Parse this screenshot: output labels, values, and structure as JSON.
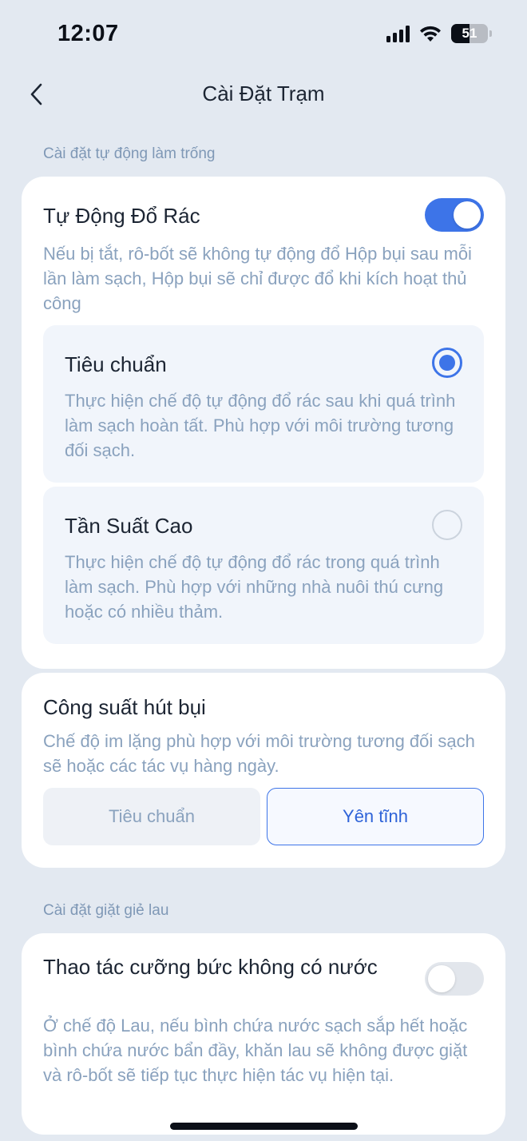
{
  "status_bar": {
    "time": "12:07",
    "battery_level": "51"
  },
  "nav": {
    "title": "Cài Đặt Trạm"
  },
  "sections": {
    "auto_empty_header": "Cài đặt tự động làm trống",
    "mop_wash_header": "Cài đặt giặt giẻ lau"
  },
  "auto_empty": {
    "title": "Tự Động Đổ Rác",
    "enabled": true,
    "description": "Nếu bị tắt, rô-bốt sẽ không tự động đổ Hộp bụi sau mỗi lần làm sạch, Hộp bụi sẽ chỉ được đổ khi kích hoạt thủ công",
    "options": [
      {
        "title": "Tiêu chuẩn",
        "description": "Thực hiện chế độ tự động đổ rác sau khi quá trình làm sạch hoàn tất. Phù hợp với môi trường tương đối sạch.",
        "selected": true
      },
      {
        "title": "Tần Suất Cao",
        "description": "Thực hiện chế độ tự động đổ rác trong quá trình làm sạch. Phù hợp với những nhà nuôi thú cưng hoặc có nhiều thảm.",
        "selected": false
      }
    ]
  },
  "suction": {
    "title": "Công suất hút bụi",
    "description": "Chế độ im lặng phù hợp với môi trường tương đối sạch sẽ hoặc các tác vụ hàng ngày.",
    "options": [
      "Tiêu chuẩn",
      "Yên tĩnh"
    ],
    "selected": "Yên tĩnh"
  },
  "forced_no_water": {
    "title": "Thao tác cưỡng bức không có nước",
    "enabled": false,
    "description": "Ở chế độ Lau, nếu bình chứa nước sạch sắp hết hoặc bình chứa nước bẩn đầy, khăn lau sẽ không được giặt và rô-bốt sẽ tiếp tục thực hiện tác vụ hiện tại."
  },
  "colors": {
    "accent": "#3d74e8",
    "background": "#e3e9f1",
    "secondary_text": "#8aa2be",
    "section_header": "#7f98b6",
    "toggle_off": "#e2e6ec"
  }
}
